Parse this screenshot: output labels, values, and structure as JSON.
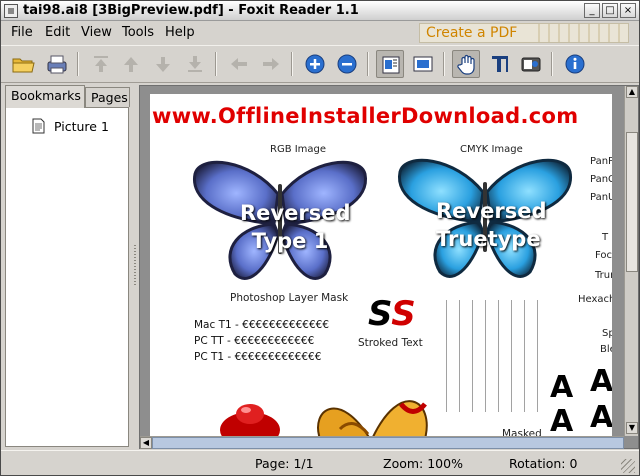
{
  "window": {
    "title": "tai98.ai8 [3BigPreview.pdf] - Foxit Reader 1.1",
    "minimize_glyph": "_",
    "maximize_glyph": "□",
    "close_glyph": "×"
  },
  "menu": {
    "items": [
      {
        "label": "File"
      },
      {
        "label": "Edit"
      },
      {
        "label": "View"
      },
      {
        "label": "Tools"
      },
      {
        "label": "Help"
      }
    ],
    "promo": "Create a PDF"
  },
  "toolbar": {
    "buttons": [
      {
        "icon": "open-folder-icon"
      },
      {
        "icon": "print-icon"
      },
      {
        "icon": "first-page-icon"
      },
      {
        "icon": "previous-page-icon"
      },
      {
        "icon": "next-page-icon"
      },
      {
        "icon": "last-page-icon"
      },
      {
        "icon": "back-icon"
      },
      {
        "icon": "forward-icon"
      },
      {
        "icon": "zoom-in-icon"
      },
      {
        "icon": "zoom-out-icon"
      },
      {
        "icon": "actual-size-icon"
      },
      {
        "icon": "fit-page-icon"
      },
      {
        "icon": "hand-tool-icon"
      },
      {
        "icon": "text-select-icon"
      },
      {
        "icon": "snapshot-icon"
      },
      {
        "icon": "about-icon"
      }
    ]
  },
  "sidebar": {
    "tabs": [
      {
        "label": "Bookmarks",
        "active": true
      },
      {
        "label": "Pages",
        "active": false
      }
    ],
    "bookmarks": [
      {
        "label": "Picture 1"
      }
    ]
  },
  "document": {
    "watermark": "www.OfflineInstallerDownload.com",
    "left_image_caption_top": "RGB Image",
    "right_image_caption_top": "CMYK Image",
    "left_butterfly_text_line1": "Reversed",
    "left_butterfly_text_line2": "Type 1",
    "right_butterfly_text_line1": "Reversed",
    "right_butterfly_text_line2": "Truetype",
    "left_caption_bottom": "Photoshop Layer Mask",
    "font_rows": [
      {
        "label": "Mac T1 - ",
        "sample": "€€€€€€€€€€€€€"
      },
      {
        "label": "PC TT - ",
        "sample": "€€€€€€€€€€€€"
      },
      {
        "label": "PC T1 - ",
        "sample": "€€€€€€€€€€€€€"
      }
    ],
    "ss_glyph_black": "S",
    "ss_glyph_red": "S",
    "stroked_text": "Stroked Text",
    "side_labels": [
      "PanPan",
      "PanCoa",
      "PanUnc",
      "T",
      "Focalt",
      "Truma",
      "Hexachro",
      "Sp",
      "Blen"
    ],
    "masked_label": "Masked",
    "big_letters": [
      "A",
      "A",
      "A",
      "A"
    ]
  },
  "status": {
    "page": "Page: 1/1",
    "zoom": "Zoom: 100%",
    "rotation": "Rotation: 0"
  },
  "colors": {
    "watermark": "#e00000",
    "butterfly_left": "#5a6fc9",
    "butterfly_right": "#2aa0e0",
    "accent_blue": "#2a6fcf",
    "promo_orange": "#d08500"
  }
}
